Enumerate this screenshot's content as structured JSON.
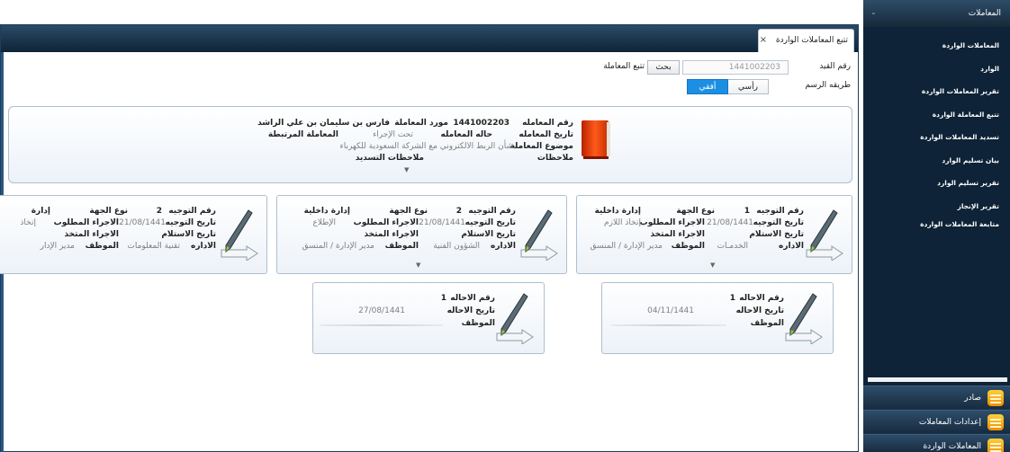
{
  "tab": {
    "title": "تتبع المعاملات الواردة",
    "close": "×"
  },
  "search": {
    "record_no_label": "رقم القيد",
    "record_no_value": "1441002203",
    "search_button": "بحث",
    "track_label": "تتبع المعاملة",
    "draw_method_label": "طريقه الرسم",
    "vertical": "رأسي",
    "horizontal": "أفقي",
    "selected": "horizontal"
  },
  "transaction": {
    "number_label": "رقم المعامله",
    "number_value": "1441002203",
    "supplier_label": "مورد المعاملة",
    "supplier_value": "فارس بن سليمان بن علي الراشد",
    "date_label": "تاريخ المعامله",
    "status_label": "حاله المعامله",
    "status_value": "تحت الإجراء",
    "related_label": "المعاملة المرتبطة",
    "subject_label": "موضوع المعاملة",
    "subject_value": "بشأن الربط الالكتروني مع الشركة السعودية للكهرباء",
    "notes_label": "ملاحظات",
    "payment_notes_label": "ملاحظات التسديد",
    "expand": "▼"
  },
  "routings": [
    {
      "no_label": "رقم التوجيه",
      "no_value": "1",
      "entity_type_label": "نوع الجهة",
      "entity_type_value": "إدارة داخلية",
      "date_label": "تاريخ التوجيه",
      "date_value": "21/08/1441",
      "required_action_label": "الاجراء المطلوب",
      "required_action_value": "إتخاذ اللازم",
      "receipt_date_label": "تاريخ الاستلام",
      "taken_action_label": "الاجراء المتخذ",
      "dept_label": "الاداره",
      "dept_value": "الخدمـات",
      "employee_label": "الموظف",
      "employee_value": "مدير الإدارة / المنسق",
      "expand": "▼"
    },
    {
      "no_label": "رقم التوجيه",
      "no_value": "2",
      "entity_type_label": "نوع الجهة",
      "entity_type_value": "إدارة داخلية",
      "date_label": "تاريخ التوجيه",
      "date_value": "21/08/1441",
      "required_action_label": "الاجراء المطلوب",
      "required_action_value": "الإطلاع",
      "receipt_date_label": "تاريخ الاستلام",
      "taken_action_label": "الاجراء المتخذ",
      "dept_label": "الاداره",
      "dept_value": "الشؤون الفنية",
      "employee_label": "الموظف",
      "employee_value": "مدير الإدارة / المنسق",
      "expand": "▼"
    },
    {
      "no_label": "رقم التوجيه",
      "no_value": "2",
      "entity_type_label": "نوع الجهة",
      "entity_type_value": "إدارة",
      "date_label": "تاريخ التوجيه",
      "date_value": "21/08/1441",
      "required_action_label": "الاجراء المطلوب",
      "required_action_value": "إتخاذ",
      "receipt_date_label": "تاريخ الاستلام",
      "taken_action_label": "الاجراء المتخذ",
      "dept_label": "الاداره",
      "dept_value": "تقنية المعلومات",
      "employee_label": "الموظف",
      "employee_value": "مدير الإدار"
    }
  ],
  "referrals": [
    {
      "no_label": "رقم الاحاله",
      "no_value": "1",
      "date_label": "تاريخ الاحاله",
      "date_value": "04/11/1441",
      "employee_label": "الموظف"
    },
    {
      "no_label": "رقم الاحاله",
      "no_value": "1",
      "date_label": "تاريخ الاحاله",
      "date_value": "27/08/1441",
      "employee_label": "الموظف"
    }
  ],
  "sidebar": {
    "header": "المعاملات",
    "items": [
      "المعاملات الواردة",
      "الوارد",
      "تقرير المعاملات الواردة",
      "تتبع المعاملة الواردة",
      "تسديد المعاملات الواردة",
      "بيان تسليم الوارد",
      "تقرير تسليم الوارد",
      "تقرير الإنجاز",
      "متابعة المعاملات الواردة"
    ],
    "sections": [
      "صادر",
      "إعدادات المعاملات",
      "المعاملات الواردة"
    ]
  },
  "colors": {
    "accent": "#1c8fe3",
    "sidebar": "#0e2337",
    "window_header": "#0e2438"
  }
}
